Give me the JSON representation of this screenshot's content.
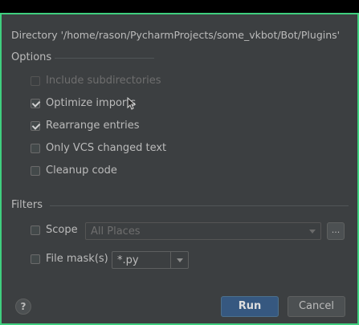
{
  "dialog": {
    "directory_label": "Directory '/home/rason/PycharmProjects/some_vkbot/Bot/Plugins'"
  },
  "options": {
    "title": "Options",
    "items": [
      {
        "label": "Include subdirectories",
        "checked": false,
        "enabled": false
      },
      {
        "label": "Optimize imports",
        "checked": true,
        "enabled": true
      },
      {
        "label": "Rearrange entries",
        "checked": true,
        "enabled": true
      },
      {
        "label": "Only VCS changed text",
        "checked": false,
        "enabled": true
      },
      {
        "label": "Cleanup code",
        "checked": false,
        "enabled": true
      }
    ]
  },
  "filters": {
    "title": "Filters",
    "scope": {
      "label": "Scope",
      "checked": false,
      "value": "All Places",
      "browse_label": "..."
    },
    "file_mask": {
      "label": "File mask(s)",
      "checked": false,
      "value": "*.py"
    }
  },
  "buttons": {
    "help_label": "?",
    "run_label": "Run",
    "cancel_label": "Cancel"
  },
  "colors": {
    "focus_border": "#3fcf7f",
    "background": "#3c3f41",
    "primary_button": "#365880"
  },
  "icons": [
    "checkmark-icon",
    "dropdown-arrow-icon",
    "help-icon",
    "mouse-cursor-icon"
  ]
}
